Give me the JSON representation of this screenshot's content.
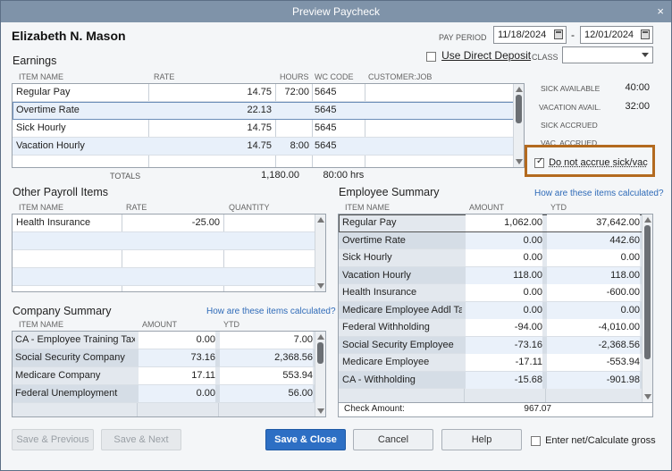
{
  "window": {
    "title": "Preview Paycheck",
    "close_glyph": "×"
  },
  "employee": {
    "name": "Elizabeth N. Mason"
  },
  "pay_period": {
    "label": "PAY PERIOD",
    "start": "11/18/2024",
    "separator": "-",
    "end": "12/01/2024"
  },
  "direct_deposit": {
    "label": "Use Direct Deposit",
    "checked": false
  },
  "class": {
    "label": "CLASS",
    "value": ""
  },
  "earnings": {
    "title": "Earnings",
    "headers": {
      "item": "ITEM NAME",
      "rate": "RATE",
      "hours": "HOURS",
      "wc": "WC CODE",
      "customer": "CUSTOMER:JOB"
    },
    "rows": [
      {
        "item": "Regular Pay",
        "rate": "14.75",
        "hours": "72:00",
        "wc": "5645",
        "customer": ""
      },
      {
        "item": "Overtime Rate",
        "rate": "22.13",
        "hours": "",
        "wc": "5645",
        "customer": ""
      },
      {
        "item": "Sick Hourly",
        "rate": "14.75",
        "hours": "",
        "wc": "5645",
        "customer": ""
      },
      {
        "item": "Vacation Hourly",
        "rate": "14.75",
        "hours": "8:00",
        "wc": "5645",
        "customer": ""
      }
    ],
    "totals_label": "TOTALS",
    "total_amount": "1,180.00",
    "total_hours": "80:00",
    "hours_unit": "hrs"
  },
  "accruals": {
    "sick_available_label": "SICK AVAILABLE",
    "sick_available": "40:00",
    "vacation_avail_label": "VACATION AVAIL.",
    "vacation_avail": "32:00",
    "sick_accrued_label": "SICK ACCRUED",
    "vac_accrued_label": "VAC. ACCRUED",
    "do_not_accrue_label": "Do not accrue sick/vac",
    "do_not_accrue_checked": true
  },
  "other_payroll": {
    "title": "Other Payroll Items",
    "headers": {
      "item": "ITEM NAME",
      "rate": "RATE",
      "quantity": "QUANTITY"
    },
    "rows": [
      {
        "item": "Health Insurance",
        "rate": "-25.00",
        "quantity": ""
      }
    ]
  },
  "employee_summary": {
    "title": "Employee Summary",
    "link": "How are these items calculated?",
    "headers": {
      "item": "ITEM NAME",
      "amount": "AMOUNT",
      "ytd": "YTD"
    },
    "rows": [
      {
        "item": "Regular Pay",
        "amount": "1,062.00",
        "ytd": "37,642.00"
      },
      {
        "item": "Overtime Rate",
        "amount": "0.00",
        "ytd": "442.60"
      },
      {
        "item": "Sick Hourly",
        "amount": "0.00",
        "ytd": "0.00"
      },
      {
        "item": "Vacation Hourly",
        "amount": "118.00",
        "ytd": "118.00"
      },
      {
        "item": "Health Insurance",
        "amount": "0.00",
        "ytd": "-600.00"
      },
      {
        "item": "Medicare Employee Addl Tax",
        "amount": "0.00",
        "ytd": "0.00"
      },
      {
        "item": "Federal Withholding",
        "amount": "-94.00",
        "ytd": "-4,010.00"
      },
      {
        "item": "Social Security Employee",
        "amount": "-73.16",
        "ytd": "-2,368.56"
      },
      {
        "item": "Medicare Employee",
        "amount": "-17.11",
        "ytd": "-553.94"
      },
      {
        "item": "CA - Withholding",
        "amount": "-15.68",
        "ytd": "-901.98"
      }
    ],
    "check_amount_label": "Check Amount:",
    "check_amount": "967.07"
  },
  "company_summary": {
    "title": "Company Summary",
    "link": "How are these items calculated?",
    "headers": {
      "item": "ITEM NAME",
      "amount": "AMOUNT",
      "ytd": "YTD"
    },
    "rows": [
      {
        "item": "CA - Employee Training Tax",
        "amount": "0.00",
        "ytd": "7.00"
      },
      {
        "item": "Social Security Company",
        "amount": "73.16",
        "ytd": "2,368.56"
      },
      {
        "item": "Medicare Company",
        "amount": "17.11",
        "ytd": "553.94"
      },
      {
        "item": "Federal Unemployment",
        "amount": "0.00",
        "ytd": "56.00"
      }
    ]
  },
  "buttons": {
    "save_previous": "Save & Previous",
    "save_next": "Save & Next",
    "save_close": "Save & Close",
    "cancel": "Cancel",
    "help": "Help",
    "enter_net_label": "Enter net/Calculate gross",
    "enter_net_checked": false
  },
  "colors": {
    "title_bar": "#7f93a9",
    "primary_button": "#2d6fc4",
    "highlight_border": "#b36a1f",
    "link": "#2f6bb8"
  }
}
